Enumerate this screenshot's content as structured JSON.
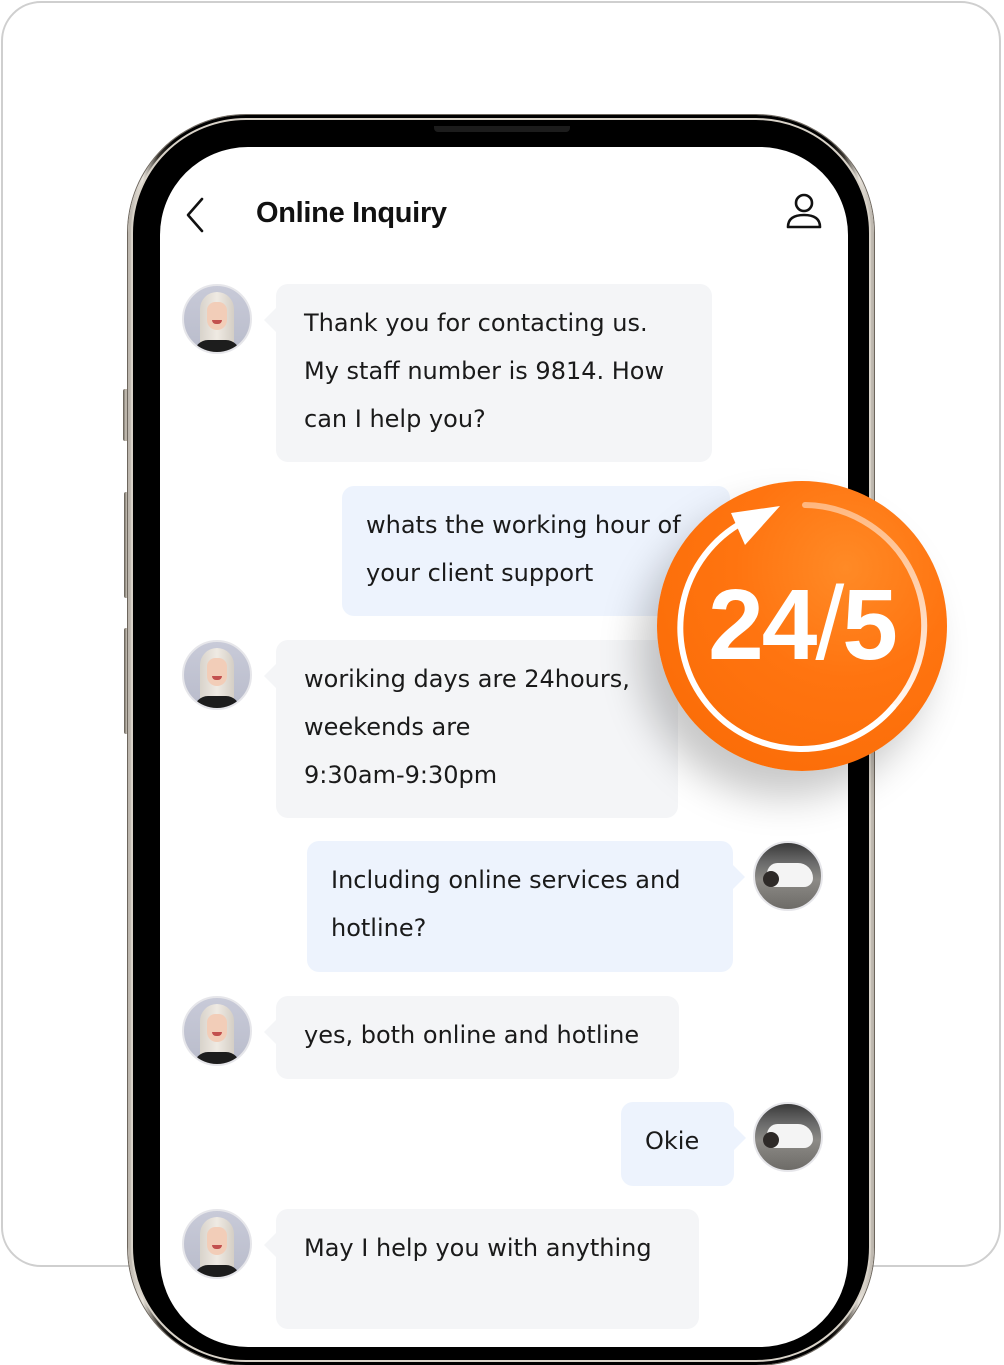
{
  "header": {
    "title": "Online Inquiry",
    "back_icon": "chevron-left-icon",
    "profile_icon": "user-icon"
  },
  "messages": [
    {
      "sender": "agent",
      "lines": [
        "Thank you for contacting us.",
        "My staff number is 9814. How",
        "can I help you?"
      ]
    },
    {
      "sender": "user",
      "lines": [
        "whats the working hour of",
        "your client support"
      ]
    },
    {
      "sender": "agent",
      "lines": [
        "woriking days are 24hours,",
        "weekends are",
        "9:30am-9:30pm"
      ]
    },
    {
      "sender": "user",
      "lines": [
        "Including online services and",
        "hotline?"
      ]
    },
    {
      "sender": "agent",
      "lines": [
        "yes, both online and hotline"
      ]
    },
    {
      "sender": "user",
      "lines": [
        "Okie"
      ]
    },
    {
      "sender": "agent",
      "lines": [
        "May I help you with anything"
      ]
    }
  ],
  "badge": {
    "left": "24",
    "slash": "/",
    "right": "5",
    "color": "#ff7410",
    "icon": "refresh-arrow-icon"
  },
  "colors": {
    "agent_bubble": "#f4f5f7",
    "user_bubble": "#edf3fd",
    "text": "#1a1a1a"
  }
}
